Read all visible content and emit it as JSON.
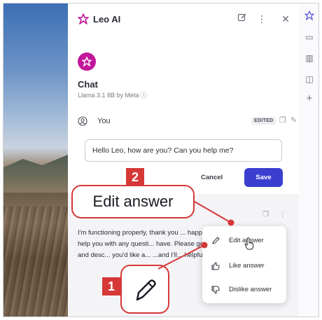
{
  "header": {
    "title": "Leo AI",
    "new_chat_icon": "edit-square-icon",
    "more_icon": "kebab-menu-icon",
    "close_icon": "close-icon"
  },
  "chat": {
    "title": "Chat",
    "model": "Llama 3.1 8B by Meta ⓘ"
  },
  "user_turn": {
    "label": "You",
    "badge": "EDITED",
    "input_value": "Hello Leo, how are you? Can you help me?",
    "cancel_label": "Cancel",
    "save_label": "Save"
  },
  "assistant_turn": {
    "text": "I'm functioning properly, thank you ... happy to help you with any questi... have. Please go ahead and desc... you'd like a... ...and I'll... helpful"
  },
  "context_menu": {
    "items": [
      {
        "label": "Edit answer",
        "icon": "pencil-icon"
      },
      {
        "label": "Like answer",
        "icon": "thumbs-up-icon"
      },
      {
        "label": "Dislike answer",
        "icon": "thumbs-down-icon"
      }
    ]
  },
  "callouts": {
    "big_label": "Edit answer",
    "step_1": "1",
    "step_2": "2"
  },
  "colors": {
    "accent": "#3b3fd0",
    "brand": "#c2179a",
    "callout_red": "#d63838"
  }
}
